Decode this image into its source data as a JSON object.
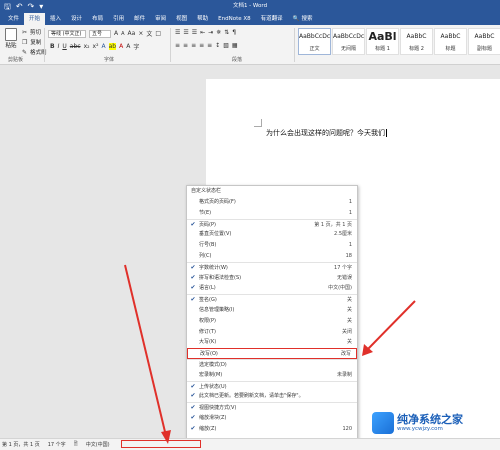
{
  "window": {
    "title": "文档1 - Word"
  },
  "quick_access": [
    "save-icon",
    "undo-icon",
    "redo-icon",
    "customize-icon"
  ],
  "tabs": [
    {
      "label": "文件"
    },
    {
      "label": "开始",
      "active": true
    },
    {
      "label": "插入"
    },
    {
      "label": "设计"
    },
    {
      "label": "布局"
    },
    {
      "label": "引用"
    },
    {
      "label": "邮件"
    },
    {
      "label": "审阅"
    },
    {
      "label": "视图"
    },
    {
      "label": "帮助"
    },
    {
      "label": "EndNote X8"
    },
    {
      "label": "有道翻译"
    }
  ],
  "search": {
    "label": "搜索"
  },
  "ribbon": {
    "clipboard": {
      "paste": "粘贴",
      "cut": "剪切",
      "copy": "复制",
      "format_painter": "格式刷",
      "group": "剪贴板"
    },
    "font": {
      "family": "等线 (中文正)",
      "size": "五号",
      "grow": "A",
      "shrink": "A",
      "group": "字体"
    },
    "paragraph": {
      "group": "段落"
    },
    "styles": [
      {
        "sample": "AaBbCcDc",
        "name": "正文",
        "selected": true
      },
      {
        "sample": "AaBbCcDc",
        "name": "无间隔"
      },
      {
        "sample": "AaBl",
        "name": "标题 1",
        "big": true
      },
      {
        "sample": "AaBbC",
        "name": "标题 2"
      },
      {
        "sample": "AaBbC",
        "name": "标题"
      },
      {
        "sample": "AaBbC",
        "name": "副标题"
      }
    ]
  },
  "document": {
    "text": "为什么会出现这样的问题呢？今天我们"
  },
  "context_menu": {
    "title": "自定义状态栏",
    "items": [
      {
        "label": "格式页的页码(F)",
        "value": "1",
        "checked": false
      },
      {
        "label": "节(E)",
        "value": "1",
        "checked": false
      },
      {
        "label": "页码(P)",
        "value": "第 1 页，共 1 页",
        "checked": true
      },
      {
        "label": "垂直页位置(V)",
        "value": "2.5厘米",
        "checked": false
      },
      {
        "label": "行号(B)",
        "value": "1",
        "checked": false
      },
      {
        "label": "列(C)",
        "value": "18",
        "checked": false
      },
      {
        "label": "字数统计(W)",
        "value": "17 个字",
        "checked": true
      },
      {
        "label": "拼写和语法检查(S)",
        "value": "无错误",
        "checked": true
      },
      {
        "label": "语言(L)",
        "value": "中文(中国)",
        "checked": true
      },
      {
        "label": "签名(G)",
        "value": "关",
        "checked": true
      },
      {
        "label": "信息管理策略(I)",
        "value": "关",
        "checked": false
      },
      {
        "label": "权限(P)",
        "value": "关",
        "checked": false
      },
      {
        "label": "修订(T)",
        "value": "关闭",
        "checked": false
      },
      {
        "label": "大写(K)",
        "value": "关",
        "checked": false
      },
      {
        "label": "改写(O)",
        "value": "改写",
        "checked": false,
        "highlighted": true
      },
      {
        "label": "选定模式(D)",
        "value": "",
        "checked": false
      },
      {
        "label": "宏录制(M)",
        "value": "未录制",
        "checked": false
      },
      {
        "label": "上传状态(U)",
        "value": "",
        "checked": true
      },
      {
        "label": "此文档已更新。若要刷新文档，请单击\"保存\"。",
        "value": "",
        "checked": true
      },
      {
        "label": "视图快捷方式(V)",
        "value": "",
        "checked": true
      },
      {
        "label": "缩放滑块(Z)",
        "value": "",
        "checked": true
      },
      {
        "label": "缩放(Z)",
        "value": "120",
        "checked": true
      }
    ]
  },
  "statusbar": {
    "page": "第 1 页，共 1 页",
    "words": "17 个字",
    "language": "中文(中国)"
  },
  "watermark": {
    "name": "纯净系统之家",
    "url": "www.ycwjzy.com"
  },
  "colors": {
    "accent": "#2b579a",
    "highlight": "#e0302a"
  }
}
